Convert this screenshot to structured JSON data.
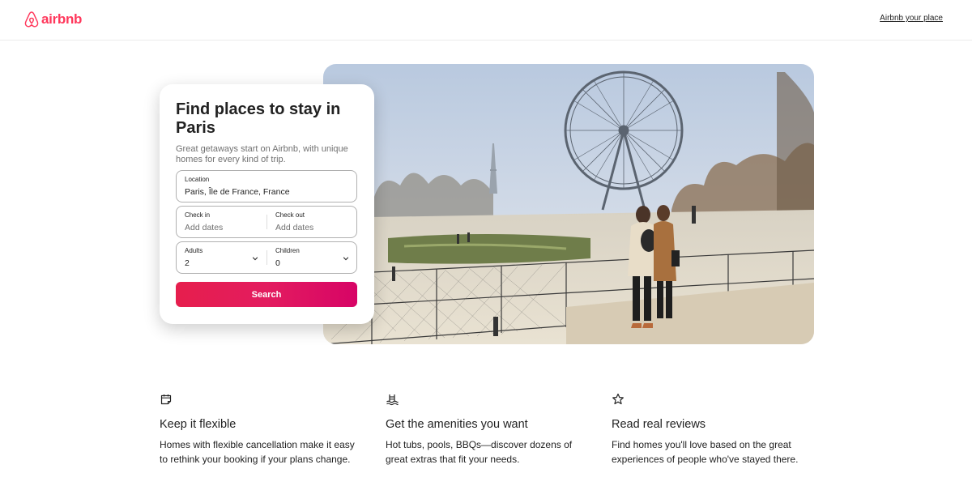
{
  "header": {
    "logo_text": "airbnb",
    "host_link": "Airbnb your place"
  },
  "search": {
    "title": "Find places to stay in Paris",
    "subtitle": "Great getaways start on Airbnb, with unique homes for every kind of trip.",
    "location": {
      "label": "Location",
      "value": "Paris, Île de France, France"
    },
    "check_in": {
      "label": "Check in",
      "placeholder": "Add dates"
    },
    "check_out": {
      "label": "Check out",
      "placeholder": "Add dates"
    },
    "adults": {
      "label": "Adults",
      "value": "2"
    },
    "children": {
      "label": "Children",
      "value": "0"
    },
    "button": "Search"
  },
  "features": [
    {
      "icon": "calendar-icon",
      "title": "Keep it flexible",
      "description": "Homes with flexible cancellation make it easy to rethink your booking if your plans change."
    },
    {
      "icon": "pool-icon",
      "title": "Get the amenities you want",
      "description": "Hot tubs, pools, BBQs—discover dozens of great extras that fit your needs."
    },
    {
      "icon": "star-icon",
      "title": "Read real reviews",
      "description": "Find homes you'll love based on the great experiences of people who've stayed there."
    }
  ],
  "colors": {
    "brand": "#FF385C",
    "button_start": "#E61E4D",
    "button_end": "#D70466"
  }
}
